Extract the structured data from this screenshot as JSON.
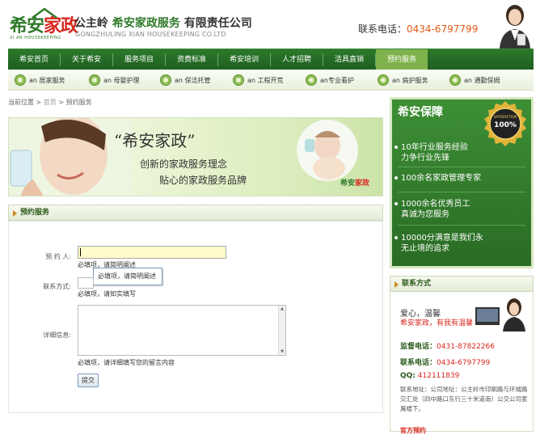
{
  "header": {
    "logo_cn_a": "希安",
    "logo_cn_b": "家政",
    "logo_en": "XI AN HOUSEKEEPING",
    "company_prefix": "公主岭 ",
    "company_main": "希安家政服务",
    "company_suffix": " 有限责任公司",
    "company_en": "GONGZHULING  XIAN HOUSEKEEPING CO.LTD",
    "phone_label": "联系电话：",
    "phone_number": "0434-6797799"
  },
  "nav": {
    "items": [
      {
        "label": "希安首页"
      },
      {
        "label": "关于希安"
      },
      {
        "label": "服务项目"
      },
      {
        "label": "资费标准"
      },
      {
        "label": "希安培训"
      },
      {
        "label": "人才招聘"
      },
      {
        "label": "洁具直销"
      },
      {
        "label": "预约服务"
      }
    ],
    "active_index": 7
  },
  "subnav": {
    "items": [
      {
        "label": "an  居家服务"
      },
      {
        "label": "an  母婴护理"
      },
      {
        "label": "an  保洁托管"
      },
      {
        "label": "an  工程开荒"
      },
      {
        "label": "an专业看护"
      },
      {
        "label": "an  病护服务"
      },
      {
        "label": "an  通勤保姆"
      }
    ]
  },
  "breadcrumb": {
    "prefix": "当前位置 > ",
    "home": "首页",
    "sep": " > ",
    "current": "预约服务"
  },
  "banner": {
    "slogan": "“希安家政”",
    "line1": "创新的家政服务理念",
    "line2": "贴心的家政服务品牌",
    "logo_a": "希安",
    "logo_b": "家政"
  },
  "form": {
    "section_title": "预约服务",
    "fields": [
      {
        "label": "预 约 人:",
        "hint": "必填项，请简明阐述"
      },
      {
        "label": "联系方式:",
        "hint": "必填项，请如实填写"
      },
      {
        "label": "详细信息:",
        "hint": "必填项，请详细填写您的留言内容"
      }
    ],
    "tooltip": "必填项，请简明阐述",
    "submit_label": "提交"
  },
  "sidebar": {
    "guarantee_title": "希安保障",
    "badge_top": "SATISFACTION",
    "badge_num": "100%",
    "guarantee_items": [
      {
        "line1": "10年行业服务经验",
        "line2": "力争行业先锋"
      },
      {
        "line1": "100余名家政管理专家",
        "line2": ""
      },
      {
        "line1": "1000余名优秀员工",
        "line2": "真诚为您服务"
      },
      {
        "line1": "10000分满意是我们永",
        "line2": "无止境的追求"
      }
    ],
    "contact_title": "联系方式",
    "tagline1": "爱心，温馨",
    "tagline2": "希安家政，有我有温馨",
    "supervise_label": "监督电话：",
    "supervise_value": "0431-87822266",
    "contact_label": "联系电话：",
    "contact_value": "0434-6797799",
    "qq_label": "QQ:",
    "qq_value": "412111839",
    "address": "联系地址：公司地址：公主岭市印刷路与环城路交汇处（四中路口东行三十米道南）公交公司家属楼下。",
    "bottom_label": "官方预约"
  },
  "colors": {
    "primary_green": "#2a6b25",
    "accent_red": "#d7261e",
    "phone_orange": "#e25a12"
  }
}
